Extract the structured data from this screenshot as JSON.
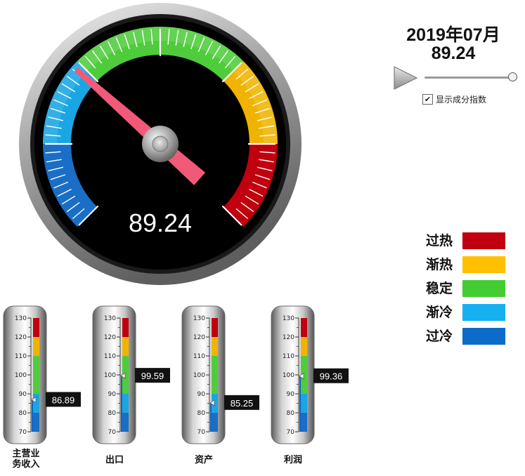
{
  "header": {
    "date": "2019年07月",
    "value": "89.24"
  },
  "controls": {
    "play_icon": "play-triangle-icon",
    "slider_level": 1.0,
    "show_components_checked": true,
    "show_components_label": "显示成分指数"
  },
  "main_gauge": {
    "value": 89.24,
    "display": "89.24",
    "min": 70,
    "max": 130,
    "bands": [
      {
        "from": 70,
        "to": 80,
        "color": "#1a6ec5"
      },
      {
        "from": 80,
        "to": 90,
        "color": "#1aa6e3"
      },
      {
        "from": 90,
        "to": 110,
        "color": "#4fcc3b"
      },
      {
        "from": 110,
        "to": 120,
        "color": "#f0b400"
      },
      {
        "from": 120,
        "to": 130,
        "color": "#c0000e"
      }
    ],
    "needle_color": "#f05a78"
  },
  "legend": [
    {
      "label": "过热",
      "color": "#c0000e"
    },
    {
      "label": "渐热",
      "color": "#ffc000"
    },
    {
      "label": "稳定",
      "color": "#44cc33"
    },
    {
      "label": "渐冷",
      "color": "#15b0f0"
    },
    {
      "label": "过冷",
      "color": "#0a6cc8"
    }
  ],
  "thermometers": {
    "ticks": [
      "130",
      "120",
      "110",
      "100",
      "90",
      "80",
      "70"
    ],
    "items": [
      {
        "label_lines": [
          "主营业",
          "务收入"
        ],
        "value": 86.89,
        "display": "86.89"
      },
      {
        "label_lines": [
          "出口"
        ],
        "value": 99.59,
        "display": "99.59"
      },
      {
        "label_lines": [
          "资产"
        ],
        "value": 85.25,
        "display": "85.25"
      },
      {
        "label_lines": [
          "利润"
        ],
        "value": 99.36,
        "display": "99.36"
      }
    ]
  }
}
